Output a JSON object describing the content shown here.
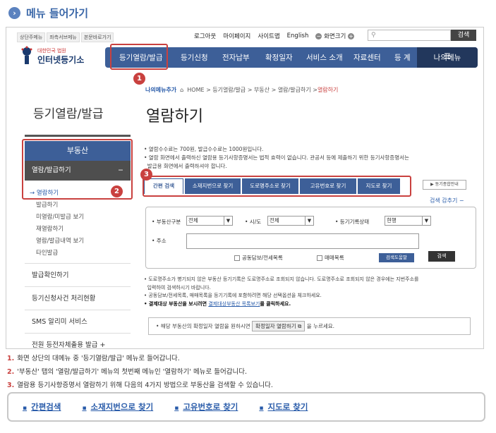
{
  "guide": {
    "title": "메뉴 들어가기"
  },
  "site": {
    "top_links": [
      "상단주메뉴",
      "좌측서브메뉴",
      "본문바로가기"
    ],
    "util": {
      "login": "로그아웃",
      "mypage": "마이페이지",
      "sitemap": "사이트맵",
      "lang": "English",
      "font_label": "화면크기",
      "search_btn": "검색"
    },
    "logo": {
      "line1": "대한민국 법원",
      "line2": "인터넷등기소"
    },
    "gnb": [
      "등기열람/발급",
      "등기신청",
      "전자납부",
      "확정일자",
      "서비스 소개",
      "자료센터",
      "등 계"
    ],
    "my_menu": "나의메뉴",
    "breadcrumb": {
      "my": "나의메뉴추가",
      "path": "HOME > 등기열람/발급 > 부동산 > 열람/발급하기 > ",
      "current": "열람하기"
    },
    "side_title": "등기열람/발급",
    "page_title": "열람하기",
    "side": {
      "category": "부동산",
      "active": "열람/발급하기",
      "active_sign": "−",
      "subs": [
        "→ 열람하기",
        "발급하기",
        "미열람/미발급 보기",
        "재열람하기",
        "열람/발급내역 보기",
        "타인발급"
      ],
      "items": [
        "발급확인하기",
        "등기신청사건 처리현황",
        "SMS 알리미 서비스",
        "전원 등전자체출용 발급 +"
      ]
    },
    "notes": [
      "• 열람수수료는 700원, 발급수수료는 1000원입니다.",
      "• 열람 화면에서 출력하신 열람용 등기사항증명서는 법적 효력이 없습니다. 관공서 등에 제출하기 위한 등기사항증명서는",
      "  발급용 화면에서 출력하셔야 합니다."
    ],
    "tabs": [
      "간편 검색",
      "소재지번으로 찾기",
      "도로명주소로 찾기",
      "고유번호로 찾기",
      "지도로 찾기"
    ],
    "detail_btn": "▶ 동기종합안내",
    "hide_search": "검색 감추기 −",
    "form": {
      "type_label": "• 부동산구분",
      "type_val": "전체",
      "sido_label": "• 시/도",
      "sido_val": "전체",
      "status_label": "• 등기기록상태",
      "status_val": "현행",
      "addr_label": "• 주소",
      "cb1": "공동담보/전세목록",
      "cb2": "매매목록",
      "help": "검색도움말",
      "find": "검색"
    },
    "notes2": [
      "• 도로명주소가 병기되지 않은 부동산 등기기록은 도로명주소로 조회되지 않습니다. 도로명주소로 조회되지 않은 경우에는 지번주소를",
      "  입력하여 검색하시기 바랍니다.",
      "• 공동담보/전세목록, 매매목록을 등기기록에 포함하려면 해당 선택옵션을 체크하세요."
    ],
    "notes2_b1": "• 결제대상 부동산을 보시려면",
    "notes2_lnk": "결제대상부동산 목록보기",
    "notes2_b2": "를 클릭하세요.",
    "bottom": {
      "pre": "• 해당 부동산의 확정일자 열람을 원하시면",
      "btn": "확정일자 열람하기",
      "post": "을 누르세요."
    },
    "callouts": [
      "1",
      "2",
      "3"
    ]
  },
  "steps": [
    {
      "n": "1.",
      "text": "화면 상단의 대메뉴 중 '등기열람/발급' 메뉴로 들어갑니다."
    },
    {
      "n": "2.",
      "text": "'부동산' 탭의 '열람/발급하기' 메뉴의 첫번째 메뉴인 '열람하기' 메뉴로 들어갑니다."
    },
    {
      "n": "3.",
      "text": "열람용 등기사항증명서 열람하기 위해 다음의 4가지 방법으로 부동산을 검색할 수 있습니다."
    }
  ],
  "methods": [
    "간편검색",
    "소재지번으로 찾기",
    "고유번호로 찾기",
    "지도로 찾기"
  ],
  "colors": {
    "accent": "#3d5f98",
    "highlight": "#c9413f",
    "link": "#2a5caa"
  }
}
